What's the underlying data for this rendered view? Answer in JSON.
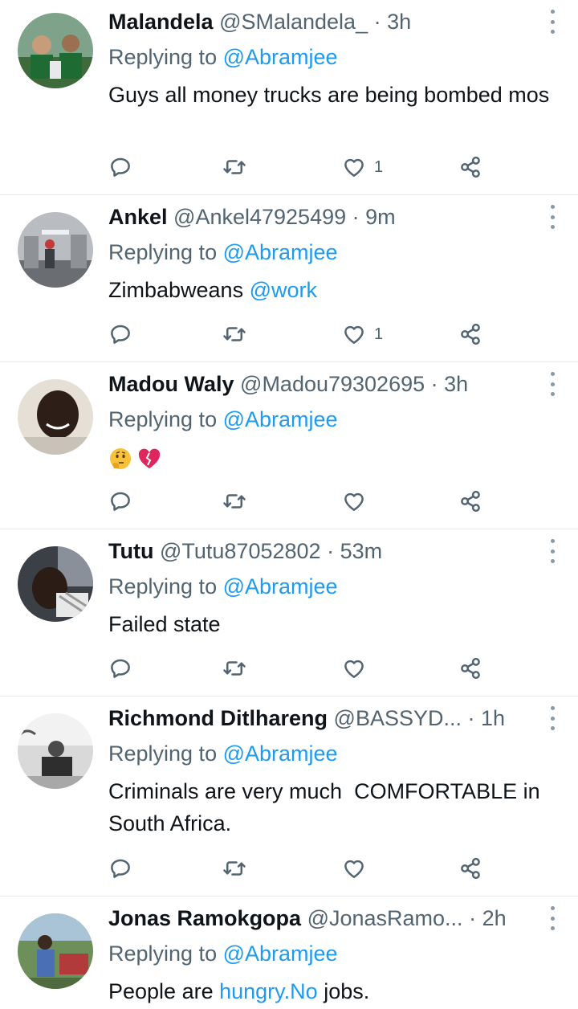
{
  "tweets": [
    {
      "name": "Malandela",
      "handle": "@SMalandela_",
      "dot": "·",
      "time": "3h",
      "reply_prefix": "Replying to",
      "reply_to": "@Abramjee",
      "text": "Guys all money trucks are being bombed mos",
      "likes": "1",
      "avatar_icon": "avatar-photo"
    },
    {
      "name": "Ankel",
      "handle": "@Ankel47925499",
      "dot": "·",
      "time": "9m",
      "reply_prefix": "Replying to",
      "reply_to": "@Abramjee",
      "text_before": "Zimbabweans ",
      "text_link": "@work",
      "likes": "1",
      "avatar_icon": "avatar-photo"
    },
    {
      "name": "Madou Waly",
      "handle": "@Madou79302695",
      "dot": "·",
      "time": "3h",
      "reply_prefix": "Replying to",
      "reply_to": "@Abramjee",
      "emojis": [
        "thinking-face-emoji",
        "broken-heart-emoji"
      ],
      "avatar_icon": "avatar-photo"
    },
    {
      "name": "Tutu",
      "handle": "@Tutu87052802",
      "dot": "·",
      "time": "53m",
      "reply_prefix": "Replying to",
      "reply_to": "@Abramjee",
      "text": "Failed state",
      "avatar_icon": "avatar-photo"
    },
    {
      "name": "Richmond Ditlhareng",
      "handle": "@BASSYD...",
      "dot": "·",
      "time": "1h",
      "reply_prefix": "Replying to",
      "reply_to": "@Abramjee",
      "text": "Criminals are very much  COMFORTABLE in South Africa.",
      "avatar_icon": "avatar-photo"
    },
    {
      "name": "Jonas Ramokgopa",
      "handle": "@JonasRamo...",
      "dot": "·",
      "time": "2h",
      "reply_prefix": "Replying to",
      "reply_to": "@Abramjee",
      "text_before": "People are ",
      "text_link": "hungry.No",
      "text_after": " jobs.",
      "avatar_icon": "avatar-photo"
    }
  ],
  "icons": {
    "reply": "reply-icon",
    "retweet": "retweet-icon",
    "like": "heart-icon",
    "share": "share-icon",
    "more": "more-vertical-icon"
  },
  "colors": {
    "link": "#1d9bf0",
    "secondary": "#536471",
    "divider": "#e6e9ec"
  }
}
